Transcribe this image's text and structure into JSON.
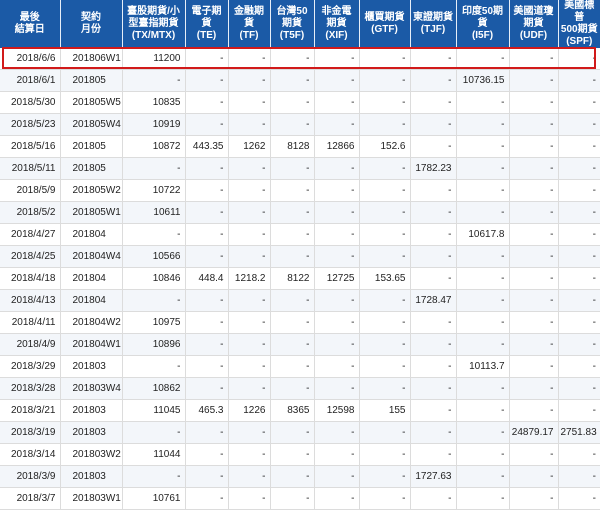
{
  "headers": [
    "最後\n結算日",
    "契約\n月份",
    "臺股期貨/小\n型臺指期貨\n(TX/MTX)",
    "電子期\n貨\n(TE)",
    "金融期\n貨\n(TF)",
    "台灣50\n期貨\n(T5F)",
    "非金電\n期貨\n(XIF)",
    "櫃買期貨\n(GTF)",
    "東證期貨\n(TJF)",
    "印度50期\n貨\n(I5F)",
    "美國道瓊\n期貨\n(UDF)",
    "美國標普\n500期貨\n(SPF)"
  ],
  "rows": [
    [
      "2018/6/6",
      "201806W1",
      "11200",
      "-",
      "-",
      "-",
      "-",
      "-",
      "-",
      "-",
      "-",
      "-"
    ],
    [
      "2018/6/1",
      "201805",
      "-",
      "-",
      "-",
      "-",
      "-",
      "-",
      "-",
      "10736.15",
      "-",
      "-"
    ],
    [
      "2018/5/30",
      "201805W5",
      "10835",
      "-",
      "-",
      "-",
      "-",
      "-",
      "-",
      "-",
      "-",
      "-"
    ],
    [
      "2018/5/23",
      "201805W4",
      "10919",
      "-",
      "-",
      "-",
      "-",
      "-",
      "-",
      "-",
      "-",
      "-"
    ],
    [
      "2018/5/16",
      "201805",
      "10872",
      "443.35",
      "1262",
      "8128",
      "12866",
      "152.6",
      "-",
      "-",
      "-",
      "-"
    ],
    [
      "2018/5/11",
      "201805",
      "-",
      "-",
      "-",
      "-",
      "-",
      "-",
      "1782.23",
      "-",
      "-",
      "-"
    ],
    [
      "2018/5/9",
      "201805W2",
      "10722",
      "-",
      "-",
      "-",
      "-",
      "-",
      "-",
      "-",
      "-",
      "-"
    ],
    [
      "2018/5/2",
      "201805W1",
      "10611",
      "-",
      "-",
      "-",
      "-",
      "-",
      "-",
      "-",
      "-",
      "-"
    ],
    [
      "2018/4/27",
      "201804",
      "-",
      "-",
      "-",
      "-",
      "-",
      "-",
      "-",
      "10617.8",
      "-",
      "-"
    ],
    [
      "2018/4/25",
      "201804W4",
      "10566",
      "-",
      "-",
      "-",
      "-",
      "-",
      "-",
      "-",
      "-",
      "-"
    ],
    [
      "2018/4/18",
      "201804",
      "10846",
      "448.4",
      "1218.2",
      "8122",
      "12725",
      "153.65",
      "-",
      "-",
      "-",
      "-"
    ],
    [
      "2018/4/13",
      "201804",
      "-",
      "-",
      "-",
      "-",
      "-",
      "-",
      "1728.47",
      "-",
      "-",
      "-"
    ],
    [
      "2018/4/11",
      "201804W2",
      "10975",
      "-",
      "-",
      "-",
      "-",
      "-",
      "-",
      "-",
      "-",
      "-"
    ],
    [
      "2018/4/9",
      "201804W1",
      "10896",
      "-",
      "-",
      "-",
      "-",
      "-",
      "-",
      "-",
      "-",
      "-"
    ],
    [
      "2018/3/29",
      "201803",
      "-",
      "-",
      "-",
      "-",
      "-",
      "-",
      "-",
      "10113.7",
      "-",
      "-"
    ],
    [
      "2018/3/28",
      "201803W4",
      "10862",
      "-",
      "-",
      "-",
      "-",
      "-",
      "-",
      "-",
      "-",
      "-"
    ],
    [
      "2018/3/21",
      "201803",
      "11045",
      "465.3",
      "1226",
      "8365",
      "12598",
      "155",
      "-",
      "-",
      "-",
      "-"
    ],
    [
      "2018/3/19",
      "201803",
      "-",
      "-",
      "-",
      "-",
      "-",
      "-",
      "-",
      "-",
      "24879.17",
      "2751.83"
    ],
    [
      "2018/3/14",
      "201803W2",
      "11044",
      "-",
      "-",
      "-",
      "-",
      "-",
      "-",
      "-",
      "-",
      "-"
    ],
    [
      "2018/3/9",
      "201803",
      "-",
      "-",
      "-",
      "-",
      "-",
      "-",
      "1727.63",
      "-",
      "-",
      "-"
    ],
    [
      "2018/3/7",
      "201803W1",
      "10761",
      "-",
      "-",
      "-",
      "-",
      "-",
      "-",
      "-",
      "-",
      "-"
    ]
  ],
  "colors": {
    "header_bg": "#1b5aa6",
    "highlight": "#d11a1a"
  }
}
